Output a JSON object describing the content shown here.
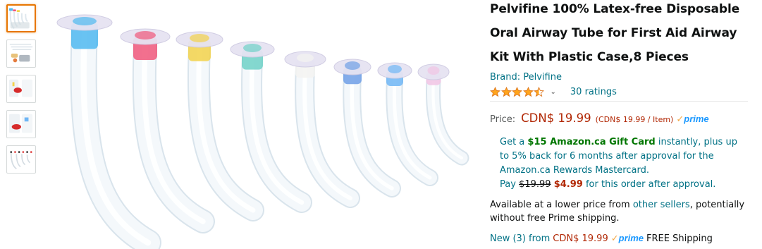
{
  "product": {
    "title": "Pelvifine 100% Latex-free Disposable Oral Airway Tube for First Aid Airway Kit With Plastic Case,8 Pieces",
    "brand_label": "Brand: Pelvifine",
    "rating_value": 4.5,
    "ratings_label": "30 ratings",
    "chevron_icon": "chevron-down-icon"
  },
  "price": {
    "label": "Price:",
    "amount": "CDN$ 19.99",
    "unit_price": "(CDN$ 19.99 / Item)",
    "prime_label": "prime"
  },
  "offer": {
    "get_a": "Get a",
    "gift_card": "$15 Amazon.ca Gift Card",
    "instantly": "instantly, plus up to 5% back for 6 months after approval for the Amazon.ca Rewards Mastercard.",
    "pay": "Pay",
    "old_price": "$19.99",
    "new_price": "$4.99",
    "after": "for this order after approval."
  },
  "availability": {
    "text_before": "Available at a lower price from",
    "link": "other sellers",
    "text_after": ", potentially without free Prime shipping."
  },
  "new_offers": {
    "link": "New (3) from",
    "price": "CDN$ 19.99",
    "prime_label": "prime",
    "shipping": "FREE Shipping"
  },
  "colors": {
    "link": "#007185",
    "price": "#b12704",
    "prime_blue": "#1a98ff",
    "prime_check": "#f3a847",
    "star": "#ffa41c",
    "gift": "#007600"
  },
  "tubes": [
    {
      "color": "#4fb9f0"
    },
    {
      "color": "#f0577a"
    },
    {
      "color": "#f2d24a"
    },
    {
      "color": "#6fd1c7"
    },
    {
      "color": "#f3f3f1"
    },
    {
      "color": "#6f9fe6"
    },
    {
      "color": "#6fb6f5"
    },
    {
      "color": "#f1c4e4"
    }
  ]
}
